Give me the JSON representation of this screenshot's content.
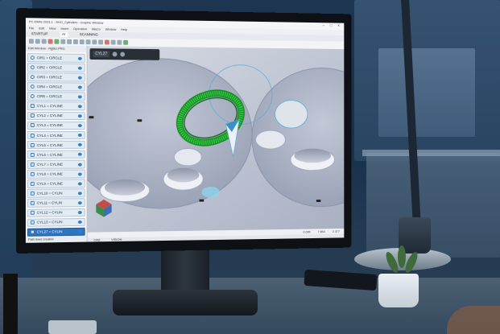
{
  "window": {
    "title": "PC-DMIS 2023.1 - SHO_Cylinders - Graphic Window",
    "controls": "– □ ×"
  },
  "menu": [
    "File",
    "Edit",
    "View",
    "Insert",
    "Operation",
    "Macro",
    "Window",
    "Help"
  ],
  "tabs": [
    {
      "label": "STARTUP",
      "active": false
    },
    {
      "label": "AI",
      "active": true
    },
    {
      "label": "SCANNING",
      "active": false
    }
  ],
  "sidebar": {
    "header": "Edit Window - RgBU.PRG",
    "items": [
      {
        "label": "CIR1 = CIRCLE",
        "kind": "circle",
        "selected": false
      },
      {
        "label": "CIR2 = CIRCLE",
        "kind": "circle",
        "selected": false
      },
      {
        "label": "CIR3 = CIRCLE",
        "kind": "circle",
        "selected": false
      },
      {
        "label": "CIR4 = CIRCLE",
        "kind": "circle",
        "selected": false
      },
      {
        "label": "CIR5 = CIRCLE",
        "kind": "circle",
        "selected": false
      },
      {
        "label": "CYL1 = CYLINE",
        "kind": "cylinder",
        "selected": false
      },
      {
        "label": "CYL2 = CYLINE",
        "kind": "cylinder",
        "selected": false
      },
      {
        "label": "CYL3 = CYLINE",
        "kind": "cylinder",
        "selected": false
      },
      {
        "label": "CYL4 = CYLINE",
        "kind": "cylinder",
        "selected": false
      },
      {
        "label": "CYL5 = CYLINE",
        "kind": "cylinder",
        "selected": false
      },
      {
        "label": "CYL6 = CYLINE",
        "kind": "cylinder",
        "selected": false
      },
      {
        "label": "CYL7 = CYLINE",
        "kind": "cylinder",
        "selected": false
      },
      {
        "label": "CYL8 = CYLINE",
        "kind": "cylinder",
        "selected": false
      },
      {
        "label": "CYL9 = CYLINE",
        "kind": "cylinder",
        "selected": false
      },
      {
        "label": "CYL10 = CYLIN",
        "kind": "cylinder",
        "selected": false
      },
      {
        "label": "CYL11 = CYLIN",
        "kind": "cylinder",
        "selected": false
      },
      {
        "label": "CYL12 = CYLIN",
        "kind": "cylinder",
        "selected": false
      },
      {
        "label": "CYL13 = CYLIN",
        "kind": "cylinder",
        "selected": false
      },
      {
        "label": "CYL27 = CYLIN",
        "kind": "cylinder",
        "selected": true
      }
    ],
    "status": "Path lines created"
  },
  "viewport": {
    "feature_badge": "CYL27",
    "status_values": [
      "0.000",
      "7.853",
      "2.377"
    ],
    "bottom_tabs": [
      "CAD",
      "VISION"
    ]
  },
  "colors": {
    "selected": "#2f74c0",
    "highlight_scan": "#2ecc40",
    "part_surface": "#b9bfcc"
  }
}
